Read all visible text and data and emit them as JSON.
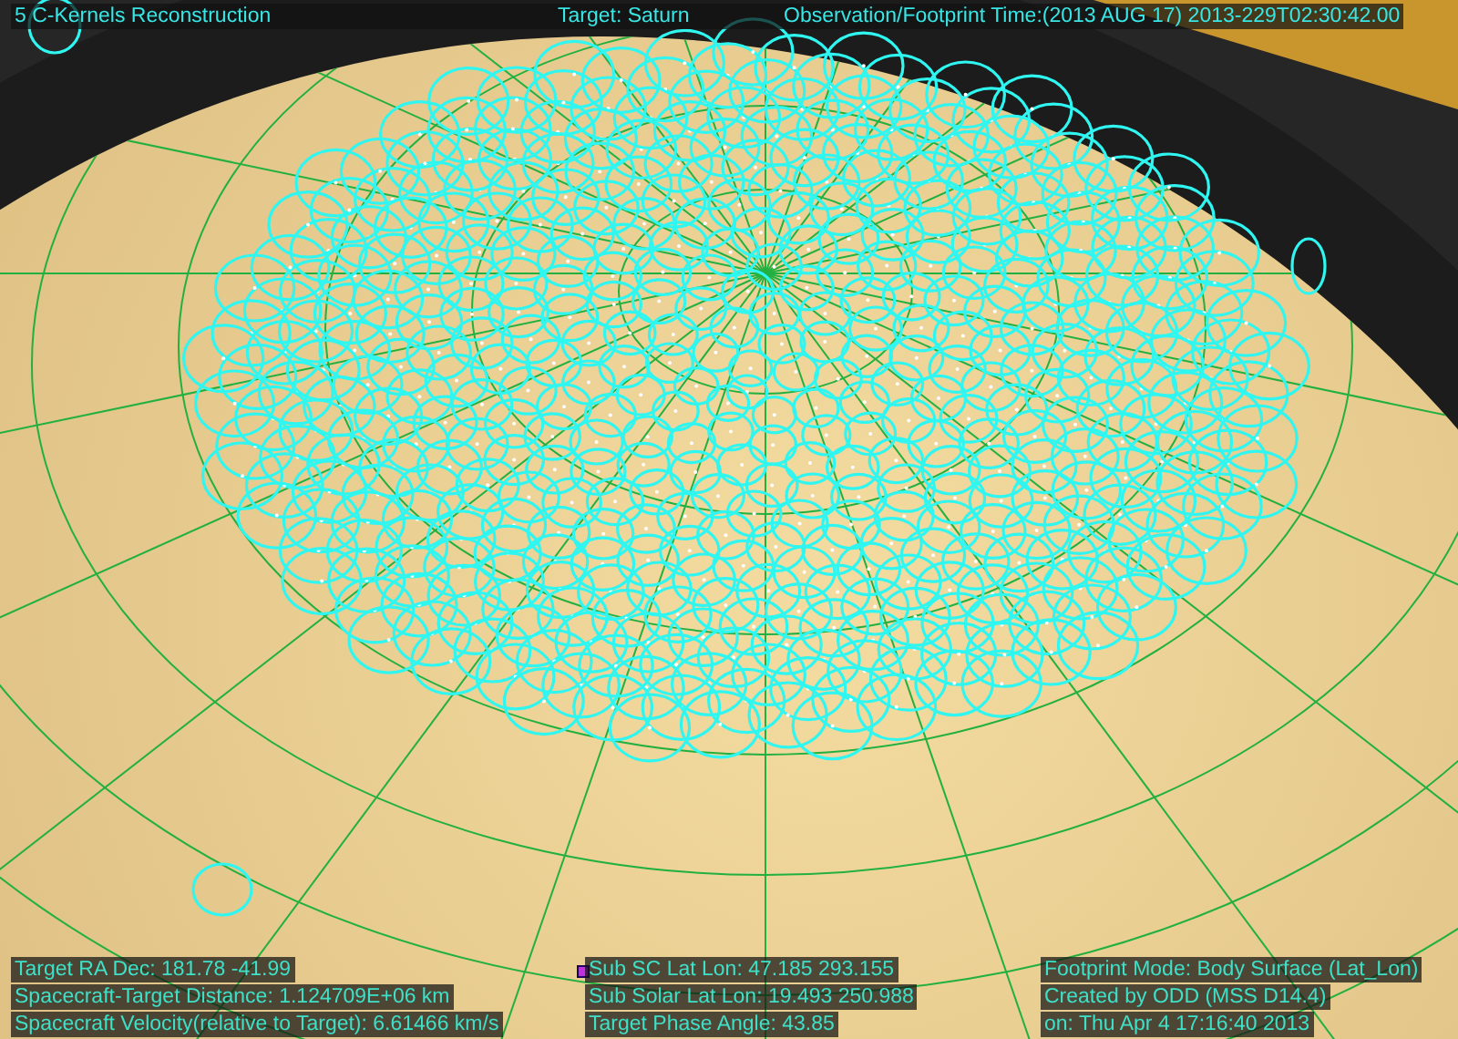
{
  "header": {
    "title": "5 C-Kernels Reconstruction",
    "target": "Target: Saturn",
    "time": "Observation/Footprint Time:(2013 AUG 17) 2013-229T02:30:42.00"
  },
  "footer": {
    "columns": [
      [
        "Target RA Dec: 181.78  -41.99",
        "Spacecraft-Target Distance: 1.124709E+06 km",
        "Spacecraft Velocity(relative to Target): 6.61466 km/s"
      ],
      [
        "Sub SC Lat Lon: 47.185  293.155",
        "Sub Solar Lat Lon: 19.493  250.988",
        "Target Phase Angle: 43.85"
      ],
      [
        "Footprint Mode: Body Surface (Lat_Lon)",
        "Created by ODD (MSS D14.4)",
        "on: Thu Apr  4 17:16:40 2013"
      ]
    ]
  }
}
